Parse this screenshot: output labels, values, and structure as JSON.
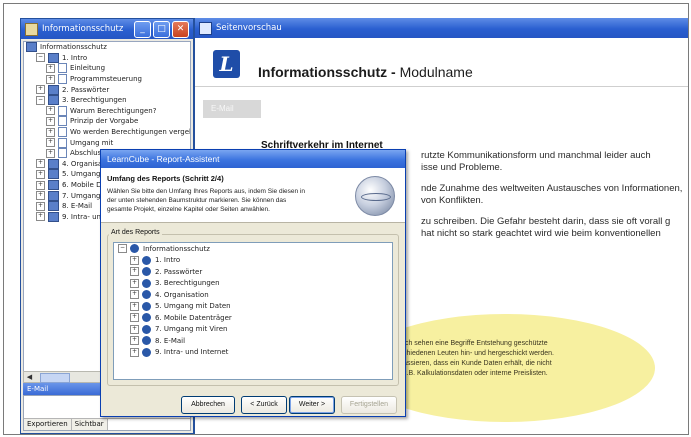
{
  "left_window": {
    "title": "Informationsschutz",
    "tree": [
      {
        "label": "Informationsschutz",
        "level": 0,
        "expander": "",
        "icon": "book"
      },
      {
        "label": "1. Intro",
        "level": 1,
        "expander": "−",
        "icon": "book"
      },
      {
        "label": "Einleitung",
        "level": 2,
        "expander": "+",
        "icon": "page"
      },
      {
        "label": "Programmsteuerung",
        "level": 2,
        "expander": "+",
        "icon": "page"
      },
      {
        "label": "2. Passwörter",
        "level": 1,
        "expander": "+",
        "icon": "book"
      },
      {
        "label": "3. Berechtigungen",
        "level": 1,
        "expander": "−",
        "icon": "book"
      },
      {
        "label": "Warum Berechtigungen?",
        "level": 2,
        "expander": "+",
        "icon": "page"
      },
      {
        "label": "Prinzip der Vorgabe",
        "level": 2,
        "expander": "+",
        "icon": "page"
      },
      {
        "label": "Wo werden Berechtigungen vergeben",
        "level": 2,
        "expander": "+",
        "icon": "page"
      },
      {
        "label": "Umgang mit",
        "level": 2,
        "expander": "+",
        "icon": "page"
      },
      {
        "label": "Abschluss",
        "level": 2,
        "expander": "+",
        "icon": "page"
      },
      {
        "label": "4. Organisation",
        "level": 1,
        "expander": "+",
        "icon": "book"
      },
      {
        "label": "5. Umgang mit",
        "level": 1,
        "expander": "+",
        "icon": "book"
      },
      {
        "label": "6. Mobile Datenträger",
        "level": 1,
        "expander": "+",
        "icon": "book"
      },
      {
        "label": "7. Umgang mit",
        "level": 1,
        "expander": "+",
        "icon": "book"
      },
      {
        "label": "8. E-Mail",
        "level": 1,
        "expander": "+",
        "icon": "book"
      },
      {
        "label": "9. Intra- und Internet",
        "level": 1,
        "expander": "+",
        "icon": "book"
      }
    ],
    "subpanel_title": "E-Mail",
    "subpanel_columns": [
      "Exportieren",
      "Sichtbar"
    ]
  },
  "right_window": {
    "title": "Seitenvorschau",
    "logo_letter": "L",
    "heading": "Informationsschutz",
    "heading_sep": " - ",
    "heading_sub": "Modulname",
    "gray_tab": "E-Mail",
    "section_heading": "Schriftverkehr im Internet",
    "paragraph_lines": [
      "rutzte Kommunikationsform und manchmal leider auch",
      "isse und Probleme.",
      "",
      "nde Zunahme des weltweiten Austausches von Informationen,",
      "von Konflikten.",
      "",
      "zu schreiben. Die Gefahr besteht darin, dass sie oft vorall g",
      "hat nicht so stark geachtet wird wie beim konventionellen"
    ],
    "bubble_lines": [
      "Ich sehen eine Begriffe Entstehung geschützte",
      "chiedenen Leuten hin- und hergeschickt werden.",
      "assieren, dass ein Kunde Daten erhält, die nicht",
      "z.B. Kalkulationsdaten oder interne Preislisten."
    ]
  },
  "dialog": {
    "title": "LearnCube - Report-Assistent",
    "header_title": "Umfang des Reports (Schritt 2/4)",
    "header_desc": [
      "Wählen Sie bitte den Umfang Ihres Reports aus, indem Sie diesen in",
      "der unten stehenden Baumstruktur markieren. Sie können das",
      "gesamte Projekt, einzelne Kapitel oder Seiten anwählen."
    ],
    "group_label": "Art des Reports",
    "tree": [
      {
        "label": "Informationsschutz",
        "level": 0,
        "expander": "−"
      },
      {
        "label": "1. Intro",
        "level": 1,
        "expander": "+"
      },
      {
        "label": "2. Passwörter",
        "level": 1,
        "expander": "+"
      },
      {
        "label": "3. Berechtigungen",
        "level": 1,
        "expander": "+"
      },
      {
        "label": "4. Organisation",
        "level": 1,
        "expander": "+"
      },
      {
        "label": "5. Umgang mit Daten",
        "level": 1,
        "expander": "+"
      },
      {
        "label": "6. Mobile Datenträger",
        "level": 1,
        "expander": "+"
      },
      {
        "label": "7. Umgang mit Viren",
        "level": 1,
        "expander": "+"
      },
      {
        "label": "8. E-Mail",
        "level": 1,
        "expander": "+"
      },
      {
        "label": "9. Intra- und Internet",
        "level": 1,
        "expander": "+"
      }
    ],
    "buttons": {
      "cancel": "Abbrechen",
      "back": "< Zurück",
      "next": "Weiter >",
      "finish": "Fertigstellen"
    }
  }
}
